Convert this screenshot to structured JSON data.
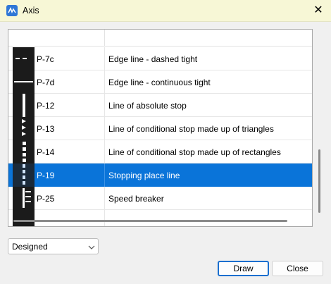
{
  "window": {
    "title": "Axis",
    "app_icon": "axis-app-icon",
    "close_icon": "close-icon",
    "close_glyph": "✕"
  },
  "list": {
    "rows": [
      {
        "code": "P-7c",
        "description": "Edge line - dashed tight"
      },
      {
        "code": "P-7d",
        "description": "Edge line - continuous tight"
      },
      {
        "code": "P-12",
        "description": "Line of absolute stop"
      },
      {
        "code": "P-13",
        "description": "Line of conditional stop made up of triangles"
      },
      {
        "code": "P-14",
        "description": "Line of conditional stop made up of rectangles"
      },
      {
        "code": "P-19",
        "description": "Stopping place line",
        "selected": true
      },
      {
        "code": "P-25",
        "description": "Speed breaker"
      }
    ],
    "selected_color": "#0a74d9"
  },
  "filter": {
    "value": "Designed"
  },
  "buttons": {
    "draw": "Draw",
    "close": "Close"
  }
}
